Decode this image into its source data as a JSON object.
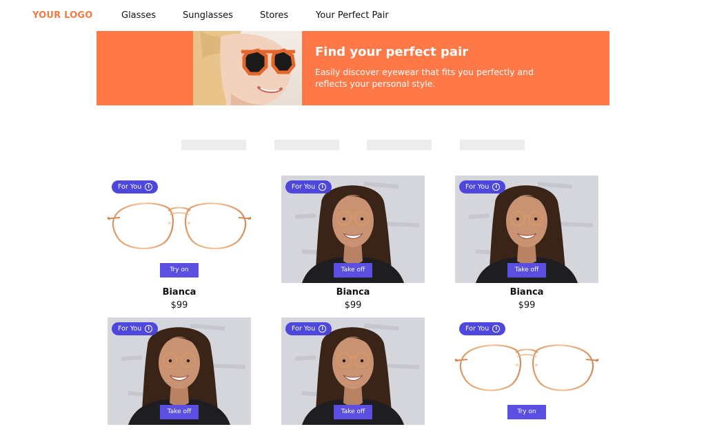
{
  "header": {
    "logo": "YOUR LOGO",
    "nav": [
      "Glasses",
      "Sunglasses",
      "Stores",
      "Your Perfect Pair"
    ]
  },
  "hero": {
    "title": "Find your perfect pair",
    "subtitle": "Easily discover eyewear that fits you perfectly and reflects your personal style."
  },
  "colors": {
    "accent": "#f07a43",
    "hero_bg": "#ff7847",
    "badge": "#4e47dc",
    "button": "#5a4fe0"
  },
  "products": [
    {
      "badge": "For You",
      "image": "frame",
      "action": "Try on",
      "name": "Bianca",
      "price": "$99"
    },
    {
      "badge": "For You",
      "image": "model",
      "action": "Take off",
      "name": "Bianca",
      "price": "$99"
    },
    {
      "badge": "For You",
      "image": "model",
      "action": "Take off",
      "name": "Bianca",
      "price": "$99"
    },
    {
      "badge": "For You",
      "image": "model",
      "action": "Take off",
      "name": "",
      "price": ""
    },
    {
      "badge": "For You",
      "image": "model",
      "action": "Take off",
      "name": "",
      "price": ""
    },
    {
      "badge": "For You",
      "image": "frame",
      "action": "Try on",
      "name": "",
      "price": ""
    }
  ]
}
